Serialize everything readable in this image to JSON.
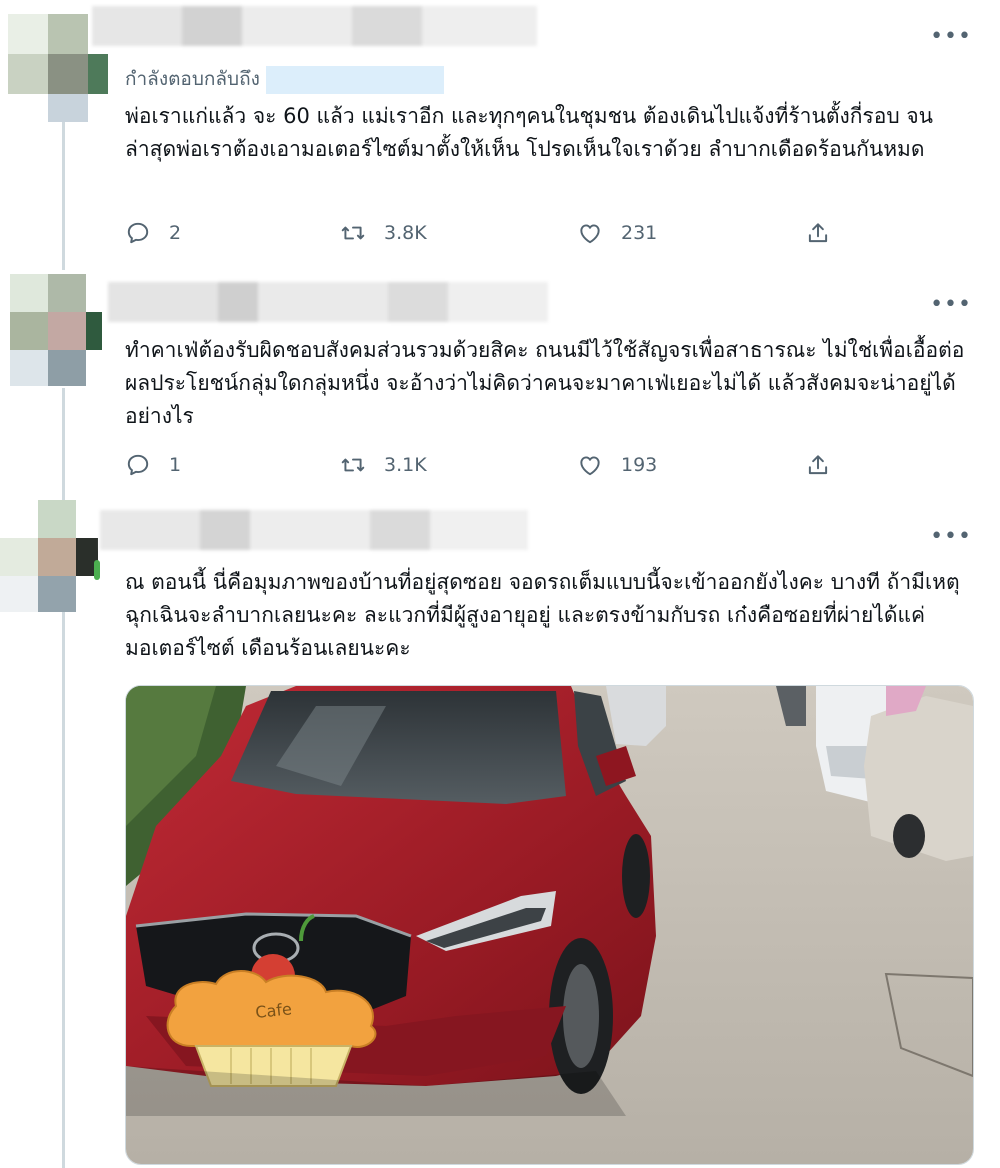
{
  "tweets": [
    {
      "replying_label": "กำลังตอบกลับถึง",
      "text": "พ่อเราแก่แล้ว จะ 60 แล้ว แม่เราอีก และทุกๆคนในชุมชน ต้องเดินไปแจ้งที่ร้านตั้งกี่รอบ จนล่าสุดพ่อเราต้องเอามอเตอร์ไซต์มาตั้งให้เห็น โปรดเห็นใจเราด้วย ลำบากเดือดร้อนกันหมด",
      "replies": "2",
      "retweets": "3.8K",
      "likes": "231"
    },
    {
      "text": "ทำคาเฟ่ต้องรับผิดชอบสังคมส่วนรวมด้วยสิคะ ถนนมีไว้ใช้สัญจรเพื่อสาธารณะ ไม่ใช่เพื่อเอื้อต่อผลประโยชน์กลุ่มใดกลุ่มหนึ่ง จะอ้างว่าไม่คิดว่าคนจะมาคาเฟ่เยอะไม่ได้ แล้วสังคมจะน่าอยู่ได้อย่างไร",
      "replies": "1",
      "retweets": "3.1K",
      "likes": "193"
    },
    {
      "text": "ณ ตอนนี้ นี่คือมุมภาพของบ้านที่อยู่สุดซอย  จอดรถเต็มแบบนี้จะเข้าออกยังไงคะ บางที ถ้ามีเหตุฉุกเฉินจะลำบากเลยนะคะ ละแวกที่มีผู้สูงอายุอยู่ และตรงข้ามกับรถ เก๋งคือซอยที่ผ่ายได้แค่มอเตอร์ไซต์ เดือนร้อนเลยนะคะ",
      "image_sticker_text": "Cafe"
    }
  ],
  "more_icon": "•••",
  "icons": {
    "reply": "speech-bubble-icon",
    "retweet": "retweet-arrows-icon",
    "like": "heart-icon",
    "share": "share-upload-icon"
  },
  "colors": {
    "text": "#0f1419",
    "muted": "#536471",
    "thread_line": "#cfd9de",
    "car_red": "#a8202c"
  }
}
